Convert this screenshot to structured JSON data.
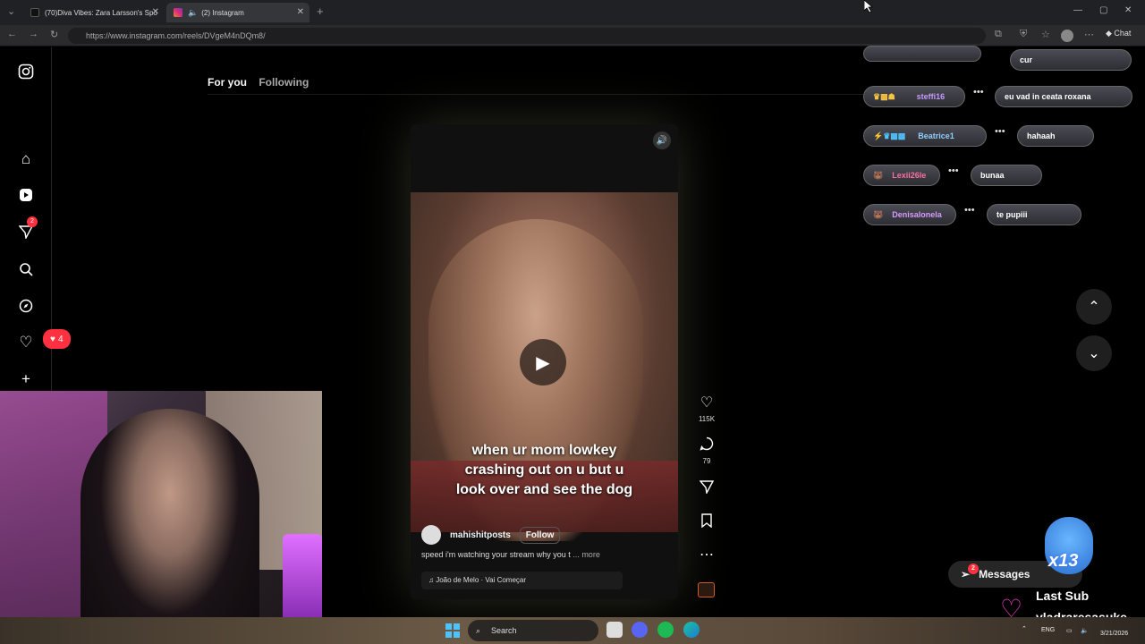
{
  "browser": {
    "tabs": [
      {
        "label": "(70)Diva Vibes: Zara Larsson's Spo",
        "active": false
      },
      {
        "label": "(2) Instagram",
        "active": true
      }
    ],
    "url": "https://www.instagram.com/reels/DVgeM4nDQm8/",
    "chat_label": "Chat"
  },
  "feed": {
    "tabs": [
      "For you",
      "Following"
    ],
    "notif_badge": "2",
    "likes_badge": "4"
  },
  "reel": {
    "caption_lines": [
      "when ur mom lowkey",
      "crashing out on u but u",
      "look over and see the dog"
    ],
    "author": "mahishitposts",
    "follow_label": "Follow",
    "description": "speed i'm watching your stream why you t",
    "more_label": "... more",
    "music": "João de Melo · Vai Começar",
    "likes": "115K",
    "comments": "79"
  },
  "chat": [
    {
      "user": "",
      "message": "cur"
    },
    {
      "user": "steffi16",
      "message": "eu vad in ceata roxana",
      "color": "#c59bff"
    },
    {
      "user": "Beatrice1",
      "message": "hahaah",
      "color": "#8fd0ff"
    },
    {
      "user": "Lexii26le",
      "message": "bunaa",
      "color": "#ff6fa0"
    },
    {
      "user": "Denisalonela",
      "message": "te pupiii",
      "color": "#d69bff"
    }
  ],
  "messages": {
    "label": "Messages",
    "badge": "2"
  },
  "overlay": {
    "multiplier": "x13",
    "last_sub_label": "Last Sub",
    "last_sub_name": "vladraresasuke"
  },
  "taskbar": {
    "search_placeholder": "Search",
    "lang": "ENG",
    "date": "3/21/2026"
  }
}
